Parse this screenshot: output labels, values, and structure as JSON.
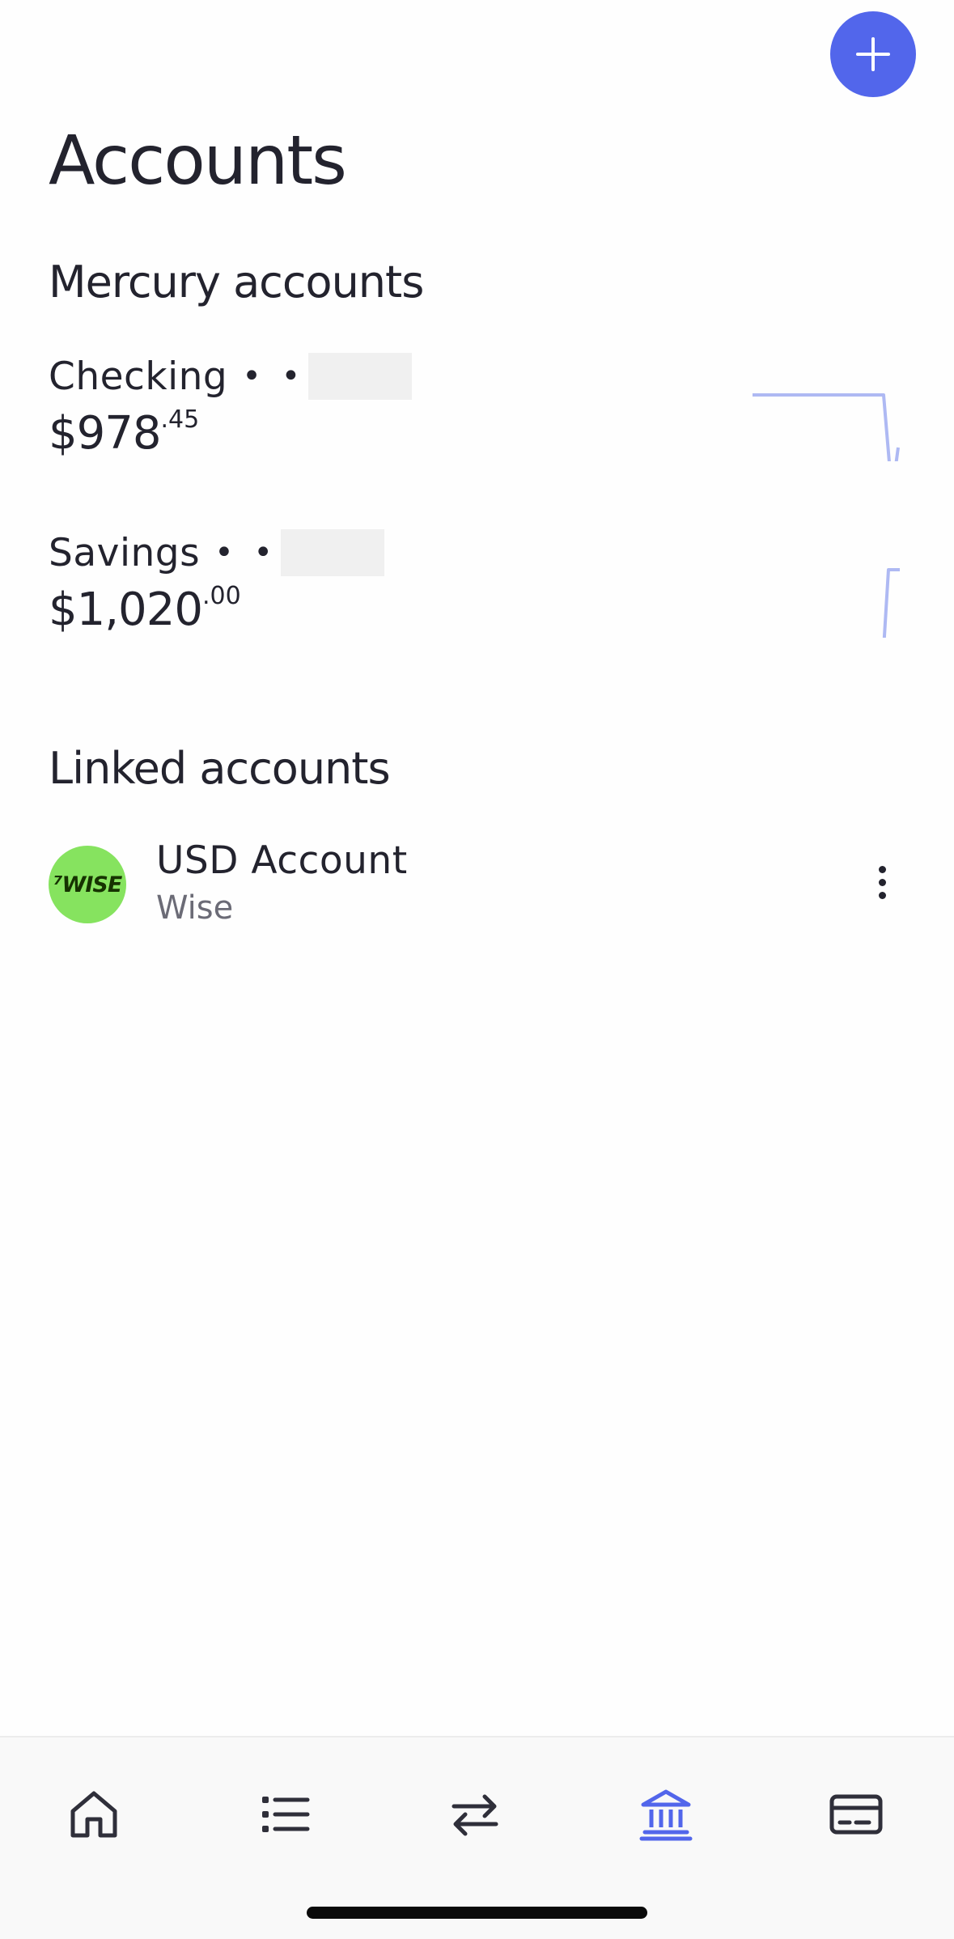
{
  "header": {
    "title": "Accounts",
    "add_icon": "plus-icon"
  },
  "mercury_accounts": {
    "section_title": "Mercury accounts",
    "items": [
      {
        "name": "Checking",
        "mask": "• •",
        "balance_main": "$978",
        "balance_cents": ".45",
        "sparkline_color": "#aeb9f3"
      },
      {
        "name": "Savings",
        "mask": "• •",
        "balance_main": "$1,020",
        "balance_cents": ".00",
        "sparkline_color": "#aeb9f3"
      }
    ]
  },
  "linked_accounts": {
    "section_title": "Linked accounts",
    "items": [
      {
        "name": "USD Account",
        "institution": "Wise",
        "logo_text": "⁷WISE",
        "logo_color": "#86e35f",
        "more_icon": "more-vertical-icon"
      }
    ]
  },
  "tab_bar": {
    "tabs": [
      {
        "icon": "home-icon",
        "active": false
      },
      {
        "icon": "list-icon",
        "active": false
      },
      {
        "icon": "transfer-arrows-icon",
        "active": false
      },
      {
        "icon": "bank-icon",
        "active": true
      },
      {
        "icon": "credit-card-icon",
        "active": false
      }
    ],
    "active_color": "#5266eb",
    "inactive_color": "#2f2f3a"
  },
  "colors": {
    "accent": "#5266eb",
    "text": "#23232e",
    "secondary_text": "#6b6b76"
  }
}
